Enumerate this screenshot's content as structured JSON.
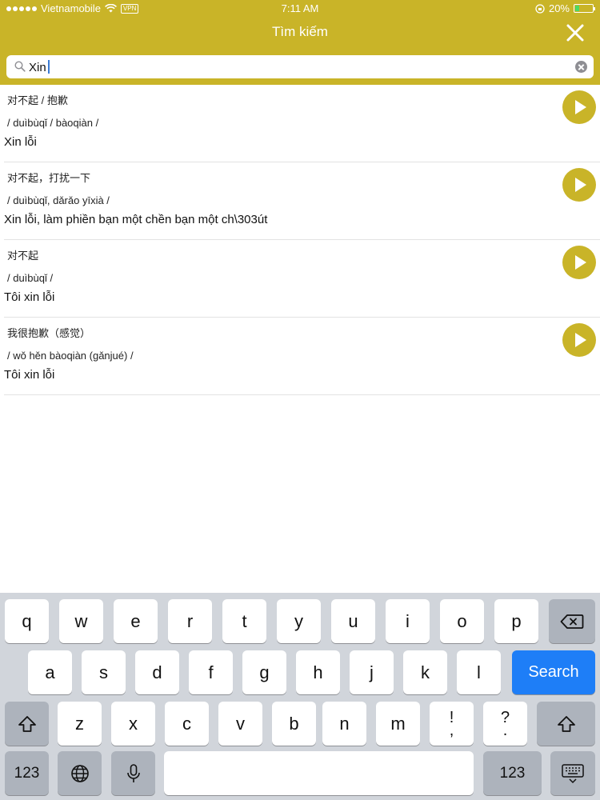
{
  "status_bar": {
    "carrier": "Vietnamobile",
    "vpn": "VPN",
    "time": "7:11 AM",
    "battery": "20%",
    "battery_level": 0.2
  },
  "header": {
    "title": "Tìm kiếm",
    "close_icon": "close-icon"
  },
  "search": {
    "value": "Xin",
    "icon": "search-icon"
  },
  "results": [
    {
      "chinese": "对不起 / 抱歉",
      "pinyin": "/ duìbùqǐ / bàoqiàn /",
      "vietnamese": "Xin lỗi"
    },
    {
      "chinese": "对不起，打扰一下",
      "pinyin": "/ duìbùqǐ, dǎrǎo yīxià /",
      "vietnamese": "Xin lỗi, làm phiền bạn một chền bạn một ch\\303út"
    },
    {
      "chinese": "对不起",
      "pinyin": "/ duìbùqǐ /",
      "vietnamese": "Tôi xin lỗi"
    },
    {
      "chinese": "我很抱歉（感觉）",
      "pinyin": "/ wǒ hěn bàoqiàn (gǎnjué) /",
      "vietnamese": "Tôi xin lỗi"
    }
  ],
  "keyboard": {
    "row1": [
      "q",
      "w",
      "e",
      "r",
      "t",
      "y",
      "u",
      "i",
      "o",
      "p"
    ],
    "row2": [
      "a",
      "s",
      "d",
      "f",
      "g",
      "h",
      "j",
      "k",
      "l"
    ],
    "row3": [
      "z",
      "x",
      "c",
      "v",
      "b",
      "n",
      "m"
    ],
    "punct1": [
      "!",
      ","
    ],
    "punct2": [
      "?",
      "."
    ],
    "search_label": "Search",
    "numbers_label": "123"
  },
  "colors": {
    "accent": "#c9b428",
    "search_key": "#1e7ef7"
  }
}
